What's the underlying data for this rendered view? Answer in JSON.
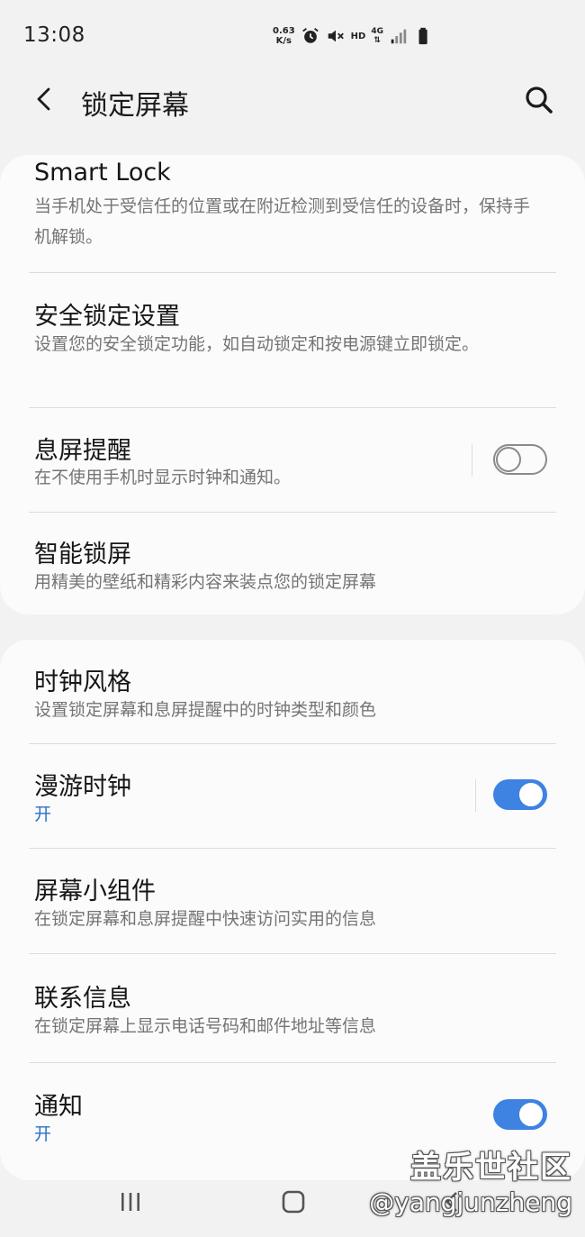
{
  "status_bar": {
    "time": "13:08",
    "net_speed_value": "0.63",
    "net_speed_unit": "K/s",
    "hd_label": "HD",
    "network_label": "4G"
  },
  "header": {
    "title": "锁定屏幕"
  },
  "card1": {
    "items": [
      {
        "title": "Smart Lock",
        "subtitle": "当手机处于受信任的位置或在附近检测到受信任的设备时，保持手机解锁。"
      },
      {
        "title": "安全锁定设置",
        "subtitle": "设置您的安全锁定功能，如自动锁定和按电源键立即锁定。"
      },
      {
        "title": "息屏提醒",
        "subtitle": "在不使用手机时显示时钟和通知。",
        "toggle": false
      },
      {
        "title": "智能锁屏",
        "subtitle": "用精美的壁纸和精彩内容来装点您的锁定屏幕"
      }
    ]
  },
  "card2": {
    "items": [
      {
        "title": "时钟风格",
        "subtitle": "设置锁定屏幕和息屏提醒中的时钟类型和颜色"
      },
      {
        "title": "漫游时钟",
        "subtitle": "开",
        "toggle": true
      },
      {
        "title": "屏幕小组件",
        "subtitle": "在锁定屏幕和息屏提醒中快速访问实用的信息"
      },
      {
        "title": "联系信息",
        "subtitle": "在锁定屏幕上显示电话号码和邮件地址等信息"
      },
      {
        "title": "通知",
        "subtitle": "开",
        "toggle": true
      }
    ]
  },
  "watermark": {
    "line1": "盖乐世社区",
    "line2": "@yangjunzheng"
  },
  "colors": {
    "background": "#f2f2f2",
    "card": "#fbfbfb",
    "accent": "#3e82e2",
    "on_text": "#2a70c4",
    "subtitle": "#747474"
  },
  "icons": {
    "back": "chevron-left-icon",
    "search": "search-icon",
    "alarm": "alarm-icon",
    "mute": "mute-icon",
    "signal": "signal-icon",
    "battery": "battery-icon",
    "nav_recent": "recent-apps-icon",
    "nav_home": "home-icon",
    "nav_back": "nav-back-icon"
  }
}
